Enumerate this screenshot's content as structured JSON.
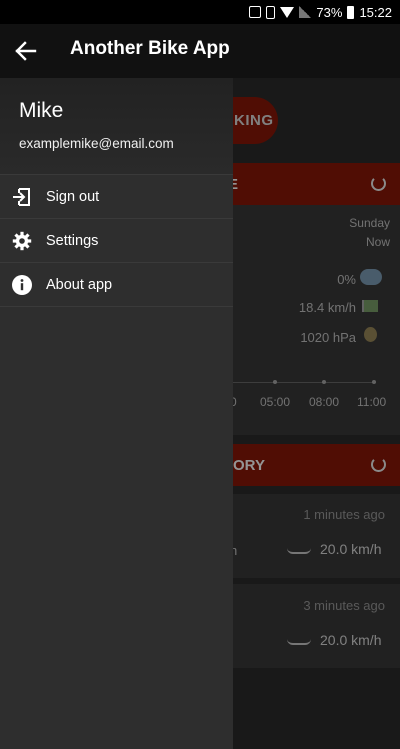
{
  "status_bar": {
    "battery": "73%",
    "time": "15:22"
  },
  "app_bar": {
    "title": "Another Bike App"
  },
  "drawer": {
    "user_name": "Mike",
    "user_email": "examplemike@email.com",
    "items": [
      {
        "label": "Sign out",
        "icon": "sign-out-icon"
      },
      {
        "label": "Settings",
        "icon": "gear-icon"
      },
      {
        "label": "About app",
        "icon": "info-icon"
      }
    ]
  },
  "background": {
    "tracking_button": "KING",
    "weather_bar_visible": "E",
    "day": "Sunday",
    "when": "Now",
    "precipitation": "0%",
    "wind": "18.4 km/h",
    "pressure": "1020 hPa",
    "time_ticks": [
      "0",
      "05:00",
      "08:00",
      "11:00"
    ],
    "history_bar_visible": "ORY",
    "rides": [
      {
        "ago": "1 minutes ago",
        "speed": "20.0 km/h",
        "partial": "h"
      },
      {
        "ago": "3 minutes ago",
        "speed": "20.0 km/h"
      }
    ]
  }
}
